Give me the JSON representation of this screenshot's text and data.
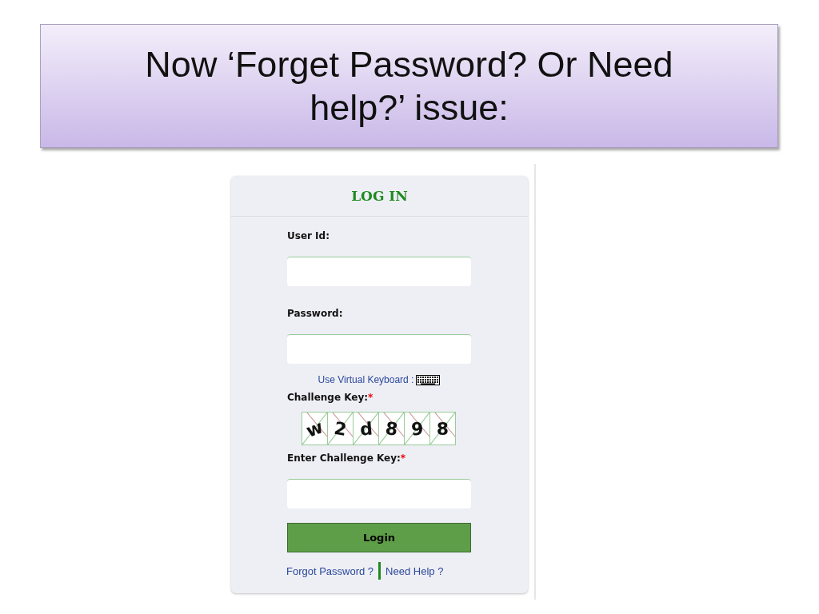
{
  "slide_title": "Now ‘Forget Password? Or Need help?’ issue:",
  "login": {
    "heading": "LOG IN",
    "fields": [
      {
        "label": "User Id:"
      },
      {
        "label": "Password:"
      }
    ],
    "virtual_keyboard_link": "Use Virtual Keyboard :",
    "challenge": {
      "label": "Challenge Key:",
      "required_mark": "*",
      "characters": [
        "w",
        "2",
        "d",
        "8",
        "9",
        "8"
      ]
    },
    "challenge_input": {
      "label": "Enter Challenge Key:",
      "required_mark": "*"
    },
    "login_button": "Login",
    "links": [
      "Forgot Password ?",
      "Need Help ?"
    ]
  }
}
